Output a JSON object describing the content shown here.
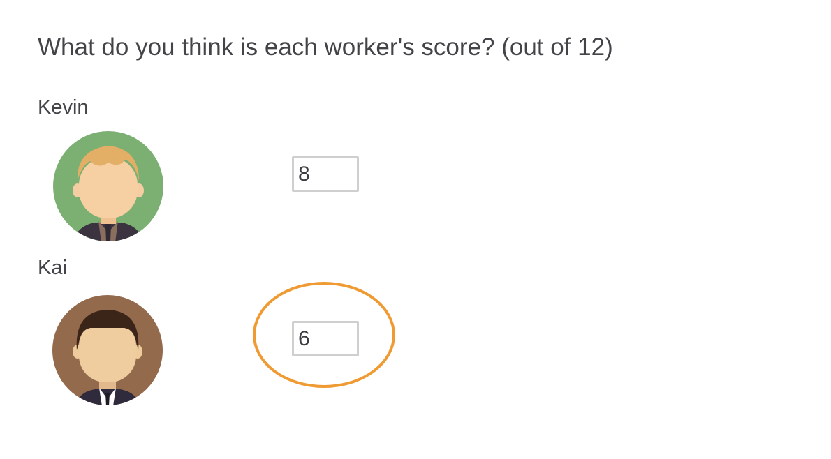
{
  "question": "What do you think is each worker's score? (out of 12)",
  "workers": [
    {
      "name": "Kevin",
      "score": "8",
      "avatar_icon": "blond-man-avatar-icon",
      "avatar_bg": "#7caf72"
    },
    {
      "name": "Kai",
      "score": "6",
      "avatar_icon": "dark-haired-man-avatar-icon",
      "avatar_bg": "#946a4d"
    }
  ],
  "highlight": {
    "color": "#ef9a32",
    "target": "Kai"
  }
}
